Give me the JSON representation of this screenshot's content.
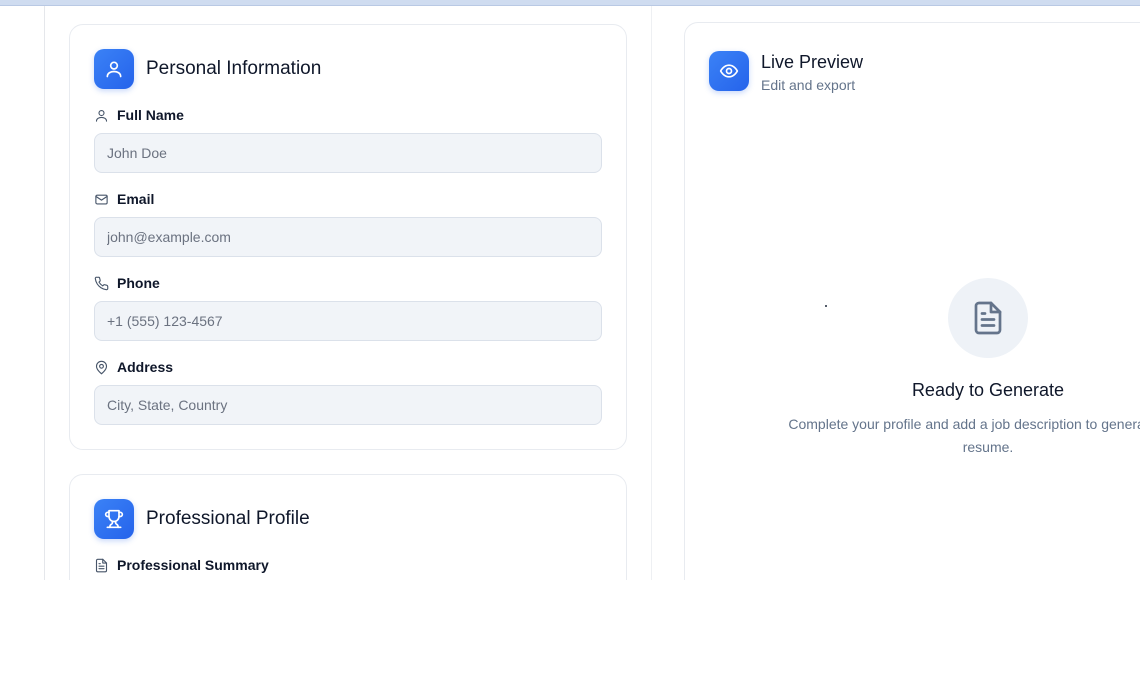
{
  "personal": {
    "title": "Personal Information",
    "fields": [
      {
        "label": "Full Name",
        "placeholder": "John Doe",
        "icon": "user-icon"
      },
      {
        "label": "Email",
        "placeholder": "john@example.com",
        "icon": "mail-icon"
      },
      {
        "label": "Phone",
        "placeholder": "+1 (555) 123-4567",
        "icon": "phone-icon"
      },
      {
        "label": "Address",
        "placeholder": "City, State, Country",
        "icon": "map-pin-icon"
      }
    ]
  },
  "professional": {
    "title": "Professional Profile",
    "summary_label": "Professional Summary",
    "icon": "trophy-icon"
  },
  "preview": {
    "title": "Live Preview",
    "subtitle": "Edit and export",
    "icon": "eye-icon",
    "empty_title": "Ready to Generate",
    "empty_text": "Complete your profile and add a job description to generate your resume."
  },
  "colors": {
    "accent": "#2563eb",
    "input_bg": "#f1f4f8",
    "muted_text": "#64748b"
  }
}
